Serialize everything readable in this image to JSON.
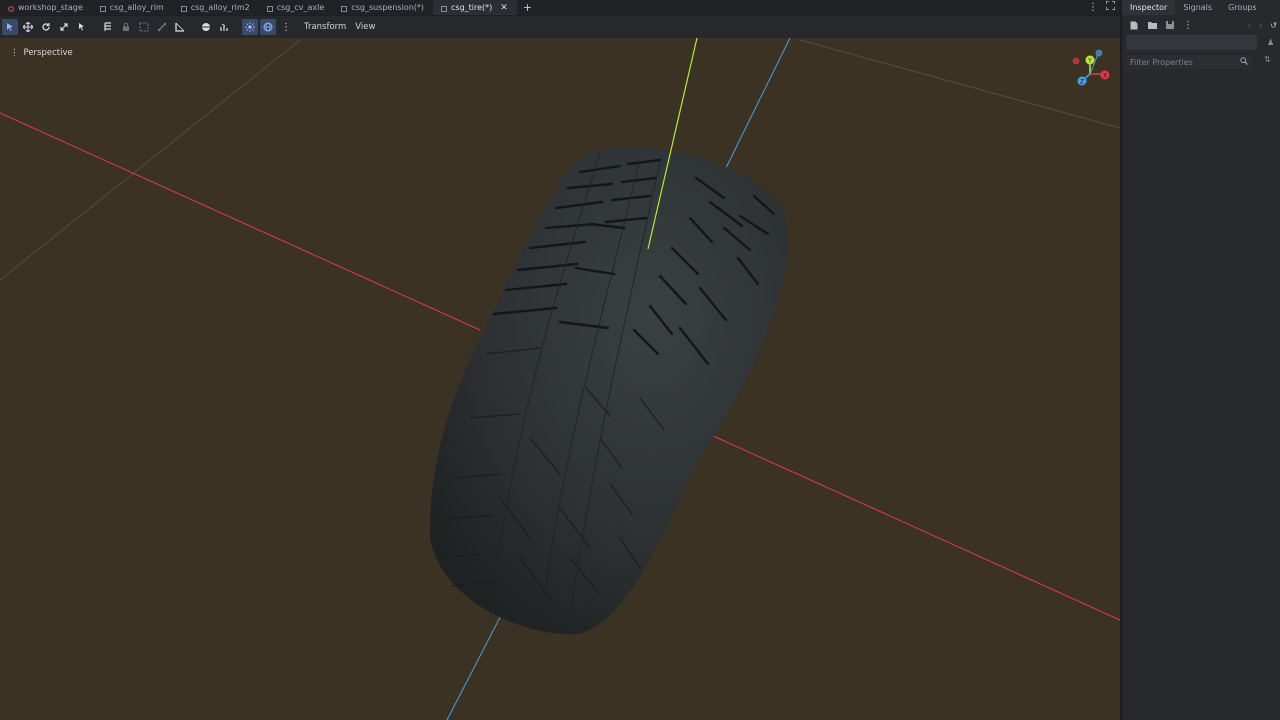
{
  "tabs": [
    {
      "label": "workshop_stage",
      "icon": "scene-root-icon",
      "active": false
    },
    {
      "label": "csg_alloy_rim",
      "icon": "csg-icon",
      "active": false
    },
    {
      "label": "csg_alloy_rim2",
      "icon": "csg-icon",
      "active": false
    },
    {
      "label": "csg_cv_axle",
      "icon": "csg-icon",
      "active": false
    },
    {
      "label": "csg_suspension(*)",
      "icon": "csg-icon",
      "active": false
    },
    {
      "label": "csg_tire(*)",
      "icon": "csg-icon",
      "active": true
    }
  ],
  "toolbar": {
    "transform_menu": "Transform",
    "view_menu": "View"
  },
  "viewport": {
    "mode_label": "Perspective",
    "gizmo": {
      "x_label": "X",
      "y_label": "Y",
      "z_label": "Z"
    }
  },
  "panel": {
    "tabs": [
      "Inspector",
      "Signals",
      "Groups"
    ],
    "filter_placeholder": "Filter Properties"
  },
  "colors": {
    "viewport_bg": "#3b3224",
    "x_axis": "#e03a4a",
    "y_axis": "#b8e83a",
    "z_axis": "#4a9fe0",
    "tire": "#2f3335"
  }
}
